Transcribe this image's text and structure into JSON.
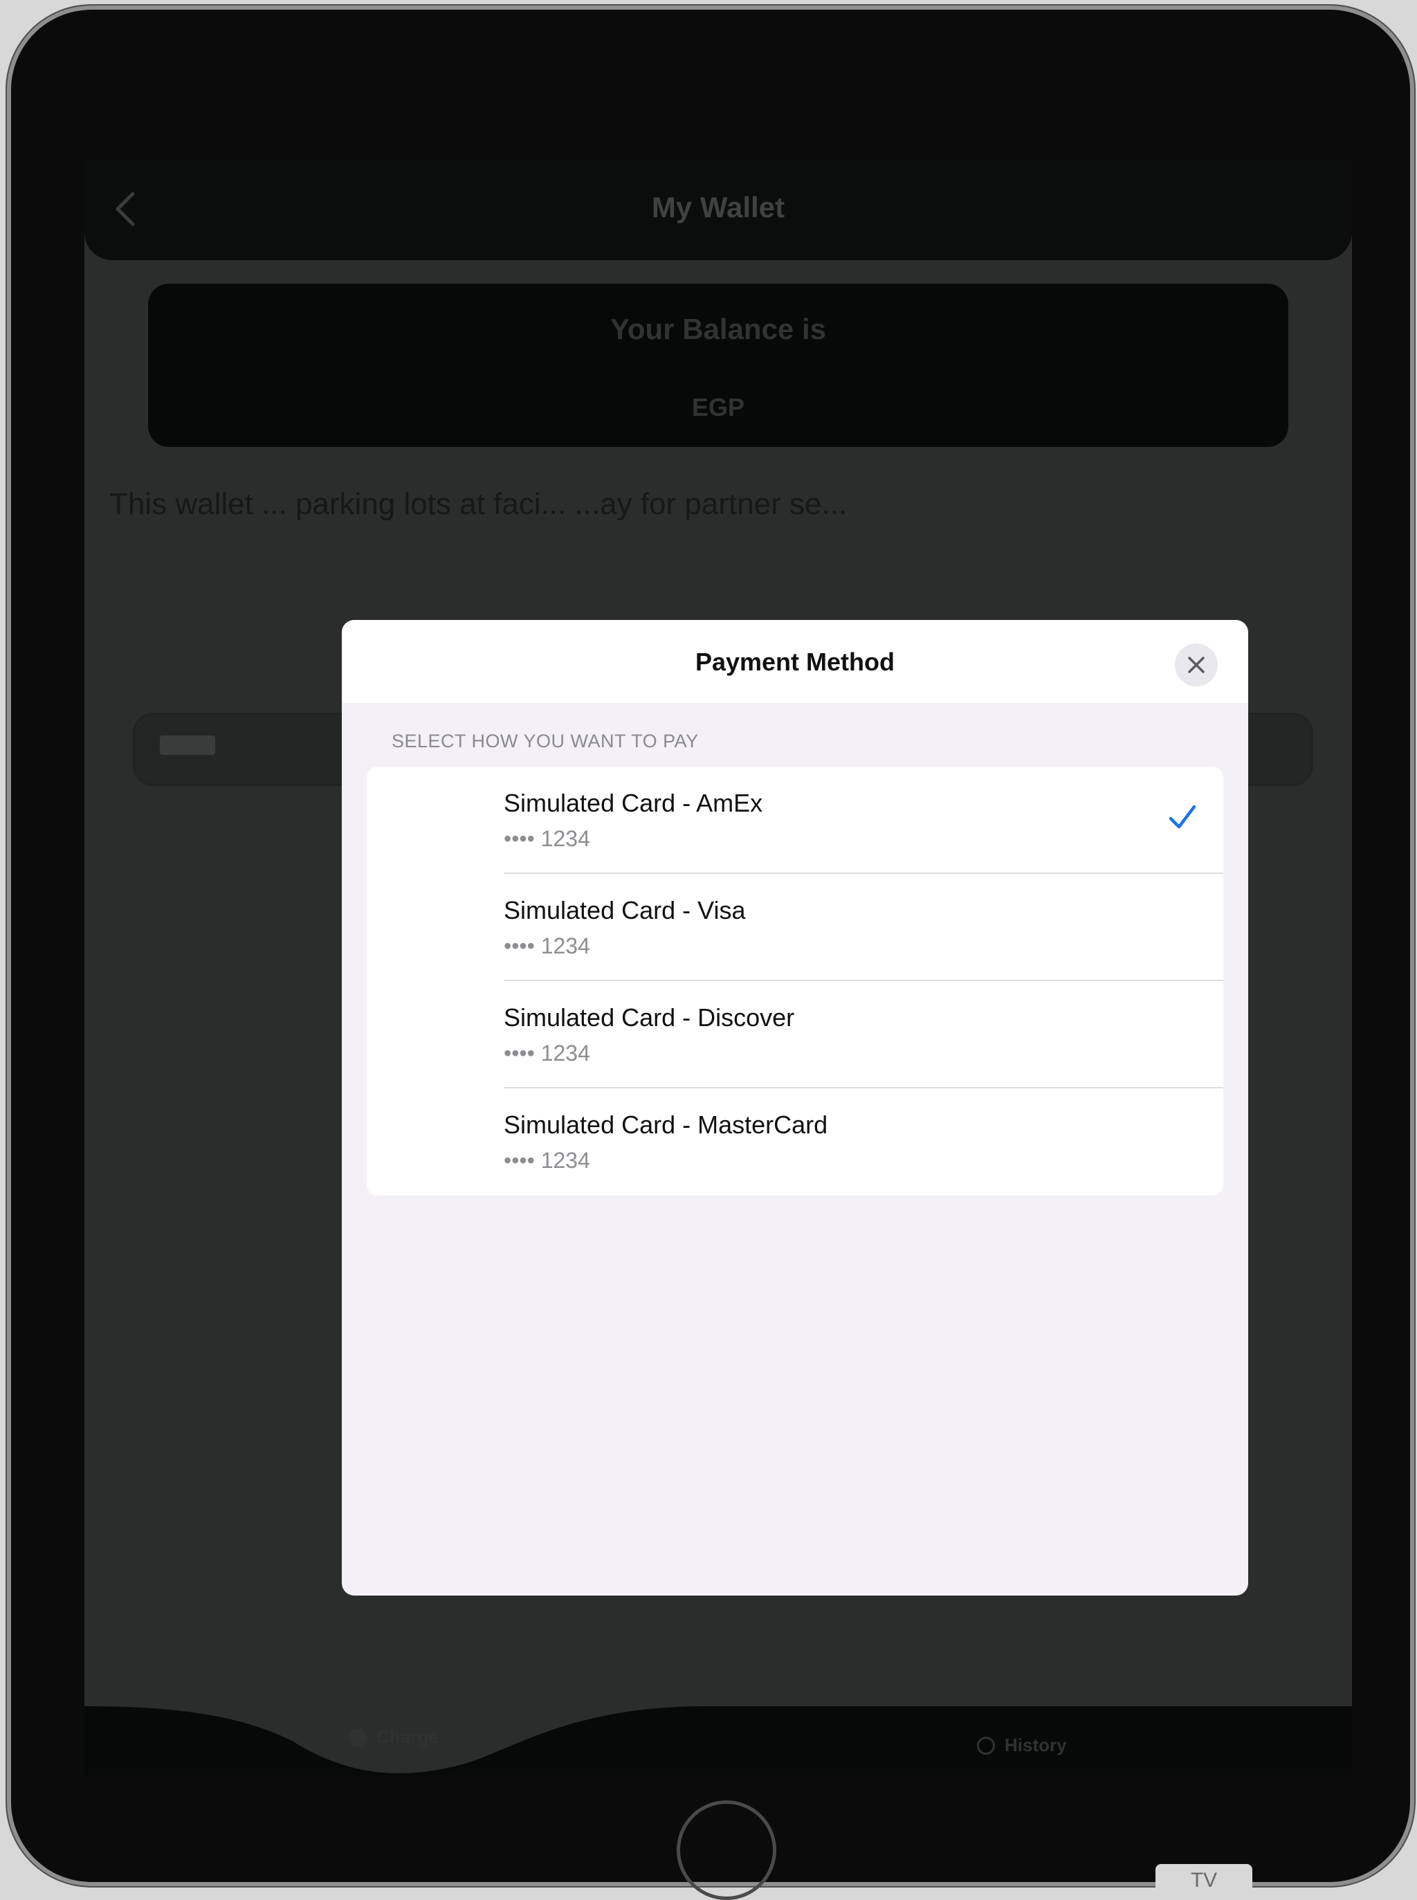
{
  "app": {
    "title": "My Wallet",
    "balance_label": "Your Balance is",
    "balance_currency": "EGP",
    "description": "This wallet ... parking lots at faci... ...ay for partner se...",
    "tabs": [
      {
        "label": "Charge",
        "icon": "charge-icon"
      },
      {
        "label": "History",
        "icon": "history-icon"
      }
    ]
  },
  "modal": {
    "title": "Payment Method",
    "section_label": "SELECT HOW YOU WANT TO PAY",
    "cards": [
      {
        "name": "Simulated Card - AmEx",
        "number": "•••• 1234",
        "selected": true
      },
      {
        "name": "Simulated Card - Visa",
        "number": "•••• 1234",
        "selected": false
      },
      {
        "name": "Simulated Card - Discover",
        "number": "•••• 1234",
        "selected": false
      },
      {
        "name": "Simulated Card - MasterCard",
        "number": "•••• 1234",
        "selected": false
      }
    ]
  },
  "colors": {
    "accent": "#1a73e8",
    "modal_background": "#f3f1f5",
    "dim_overlay": "#2b2d2c"
  },
  "device": {
    "corner_tag": "TV"
  }
}
